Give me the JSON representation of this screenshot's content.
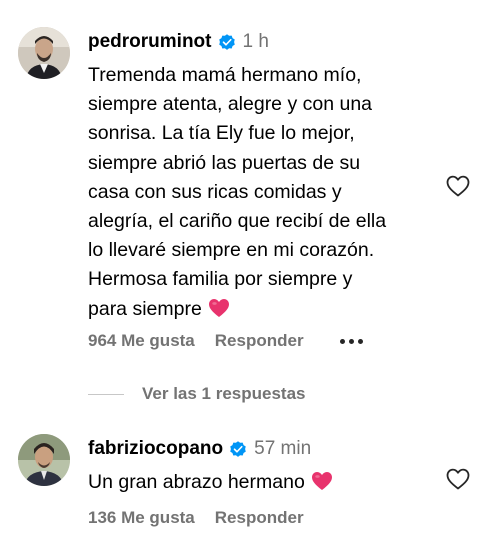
{
  "comments": [
    {
      "username": "pedroruminot",
      "time": "1 h",
      "text_lines": [
        "Tremenda mamá hermano mío,",
        "siempre atenta, alegre y con una",
        "sonrisa. La tía Ely fue lo mejor,",
        "siempre abrió las puertas de su",
        "casa con sus ricas comidas y",
        "alegría, el cariño que recibí de ella",
        "lo llevaré siempre en mi corazón.",
        "Hermosa familia por siempre y",
        "para siempre"
      ],
      "emoji": "heart-emoji",
      "likes": "964 Me gusta",
      "reply_label": "Responder",
      "verified": true
    },
    {
      "username": "fabriziocopano",
      "time": "57 min",
      "text_lines": [
        "Un gran abrazo hermano"
      ],
      "emoji": "heart-emoji",
      "likes": "136 Me gusta",
      "reply_label": "Responder",
      "verified": true
    }
  ],
  "view_replies_label": "Ver las 1 respuestas",
  "colors": {
    "verified": "#0095f6",
    "secondary_text": "#737373",
    "heart_emoji": "#e8336d"
  }
}
